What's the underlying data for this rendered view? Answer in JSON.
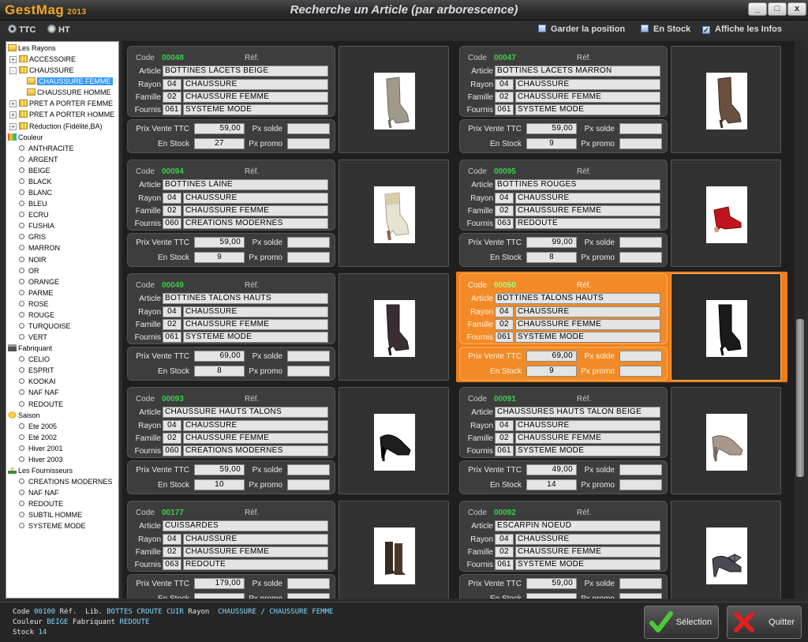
{
  "window": {
    "logo": "GestMag",
    "logo_year": "2013",
    "title": "Recherche un Article (par arborescence)",
    "controls": [
      "_",
      "□",
      "x"
    ]
  },
  "options": {
    "radio_ttc": "TTC",
    "radio_ht": "HT",
    "selected_radio": "TTC",
    "check_position": "Garder la position",
    "check_stock": "En Stock",
    "check_infos": "Affiche les Infos",
    "check_infos_checked": "✓"
  },
  "tree": {
    "rayons_root": "Les Rayons",
    "accessoire": "ACCESSOIRE",
    "chaussure": "CHAUSSURE",
    "chaussure_femme": "CHAUSSURE FEMME",
    "chaussure_homme": "CHAUSSURE HOMME",
    "pap_femme": "PRET A PORTER FEMME",
    "pap_homme": "PRET A PORTER HOMME",
    "reduction": "Réduction (Fidélité,BA)",
    "couleur_root": "Couleur",
    "couleurs": [
      "ANTHRACITE",
      "ARGENT",
      "BEIGE",
      "BLACK",
      "BLANC",
      "BLEU",
      "ECRU",
      "FUSHIA",
      "GRIS",
      "MARRON",
      "NOIR",
      "OR",
      "ORANGE",
      "PARME",
      "ROSE",
      "ROUGE",
      "TURQUOISE",
      "VERT"
    ],
    "fabriquant_root": "Fabriquant",
    "fabriquants": [
      "CELIO",
      "ESPRIT",
      "KOOKAI",
      "NAF NAF",
      "REDOUTE"
    ],
    "saison_root": "Saison",
    "saisons": [
      "Ete 2005",
      "Eté 2002",
      "Hiver 2001",
      "Hiver 2003"
    ],
    "fournisseurs_root": "Les Fournisseurs",
    "fournisseurs": [
      "CREATIONS MODERNES",
      "NAF NAF",
      "REDOUTE",
      "SUBTIL HOMME",
      "SYSTEME MODE"
    ]
  },
  "labels": {
    "code": "Code",
    "ref": "Réf.",
    "article": "Article",
    "rayon": "Rayon",
    "famille": "Famille",
    "fournis": "Fournis",
    "prix": "Prix Vente TTC",
    "stock": "En Stock",
    "solde": "Px solde",
    "promo": "Px promo"
  },
  "cards": [
    {
      "code": "00048",
      "article": "BOTTINES LACETS BEIGE",
      "rayon_code": "04",
      "rayon": "CHAUSSURE",
      "famille_code": "02",
      "famille": "CHAUSSURE FEMME",
      "fournis_code": "061",
      "fournis": "SYSTEME MODE",
      "prix": "59,00",
      "stock": "27",
      "shoe": "tall-boot-beige"
    },
    {
      "code": "00047",
      "article": "BOTTINES LACETS MARRON",
      "rayon_code": "04",
      "rayon": "CHAUSSURE",
      "famille_code": "02",
      "famille": "CHAUSSURE FEMME",
      "fournis_code": "061",
      "fournis": "SYSTEME MODE",
      "prix": "59,00",
      "stock": "9",
      "shoe": "tall-boot-brown"
    },
    {
      "code": "00094",
      "article": "BOTTINES LAINE",
      "rayon_code": "04",
      "rayon": "CHAUSSURE",
      "famille_code": "02",
      "famille": "CHAUSSURE FEMME",
      "fournis_code": "060",
      "fournis": "CREATIONS MODERNES",
      "prix": "59,00",
      "stock": "9",
      "shoe": "wool-boot"
    },
    {
      "code": "00095",
      "article": "BOTTINES ROUGES",
      "rayon_code": "04",
      "rayon": "CHAUSSURE",
      "famille_code": "02",
      "famille": "CHAUSSURE FEMME",
      "fournis_code": "063",
      "fournis": "REDOUTE",
      "prix": "99,00",
      "stock": "8",
      "shoe": "red-bootie"
    },
    {
      "code": "00049",
      "article": "BOTTINES TALONS HAUTS",
      "rayon_code": "04",
      "rayon": "CHAUSSURE",
      "famille_code": "02",
      "famille": "CHAUSSURE FEMME",
      "fournis_code": "061",
      "fournis": "SYSTEME MODE",
      "prix": "69,00",
      "stock": "8",
      "shoe": "tall-boot-dark"
    },
    {
      "code": "00050",
      "article": "BOTTINES TALONS HAUTS",
      "rayon_code": "04",
      "rayon": "CHAUSSURE",
      "famille_code": "02",
      "famille": "CHAUSSURE FEMME",
      "fournis_code": "061",
      "fournis": "SYSTEME MODE",
      "prix": "69,00",
      "stock": "9",
      "shoe": "tall-boot-black",
      "selected": true
    },
    {
      "code": "00093",
      "article": "CHAUSSURE HAUTS TALONS",
      "rayon_code": "04",
      "rayon": "CHAUSSURE",
      "famille_code": "02",
      "famille": "CHAUSSURE FEMME",
      "fournis_code": "060",
      "fournis": "CREATIONS MODERNES",
      "prix": "59,00",
      "stock": "10",
      "shoe": "black-pump"
    },
    {
      "code": "00091",
      "article": "CHAUSSURES HAUTS TALON BEIGE",
      "rayon_code": "04",
      "rayon": "CHAUSSURE",
      "famille_code": "02",
      "famille": "CHAUSSURE FEMME",
      "fournis_code": "061",
      "fournis": "SYSTEME MODE",
      "prix": "49,00",
      "stock": "14",
      "shoe": "beige-pump"
    },
    {
      "code": "00177",
      "article": "CUISSARDES",
      "rayon_code": "04",
      "rayon": "CHAUSSURE",
      "famille_code": "02",
      "famille": "CHAUSSURE FEMME",
      "fournis_code": "063",
      "fournis": "REDOUTE",
      "prix": "179,00",
      "stock": "",
      "shoe": "thigh-boots"
    },
    {
      "code": "00092",
      "article": "ESCARPIN  NOEUD",
      "rayon_code": "04",
      "rayon": "CHAUSSURE",
      "famille_code": "02",
      "famille": "CHAUSSURE FEMME",
      "fournis_code": "061",
      "fournis": "SYSTEME MODE",
      "prix": "59,00",
      "stock": "",
      "shoe": "bow-pump"
    }
  ],
  "footer": {
    "code_label": "Code",
    "code": "00100",
    "ref_label": "Réf.",
    "lib_label": "Lib.",
    "lib": "BOTTES CROUTE CUIR",
    "rayon_label": "Rayon",
    "rayon": "CHAUSSURE / CHAUSSURE FEMME",
    "couleur_label": "Couleur",
    "couleur": "BEIGE",
    "fabriquant_label": "Fabriquant",
    "fabriquant": "REDOUTE",
    "stock_label": "Stock",
    "stock": "14",
    "btn_selection": "Sélection",
    "btn_quit": "Quitter"
  },
  "colors": {
    "accent_selected": "#f07e17",
    "code_green": "#39d04a",
    "footer_value": "#7fd8ff",
    "tree_selection": "#3399ff"
  }
}
